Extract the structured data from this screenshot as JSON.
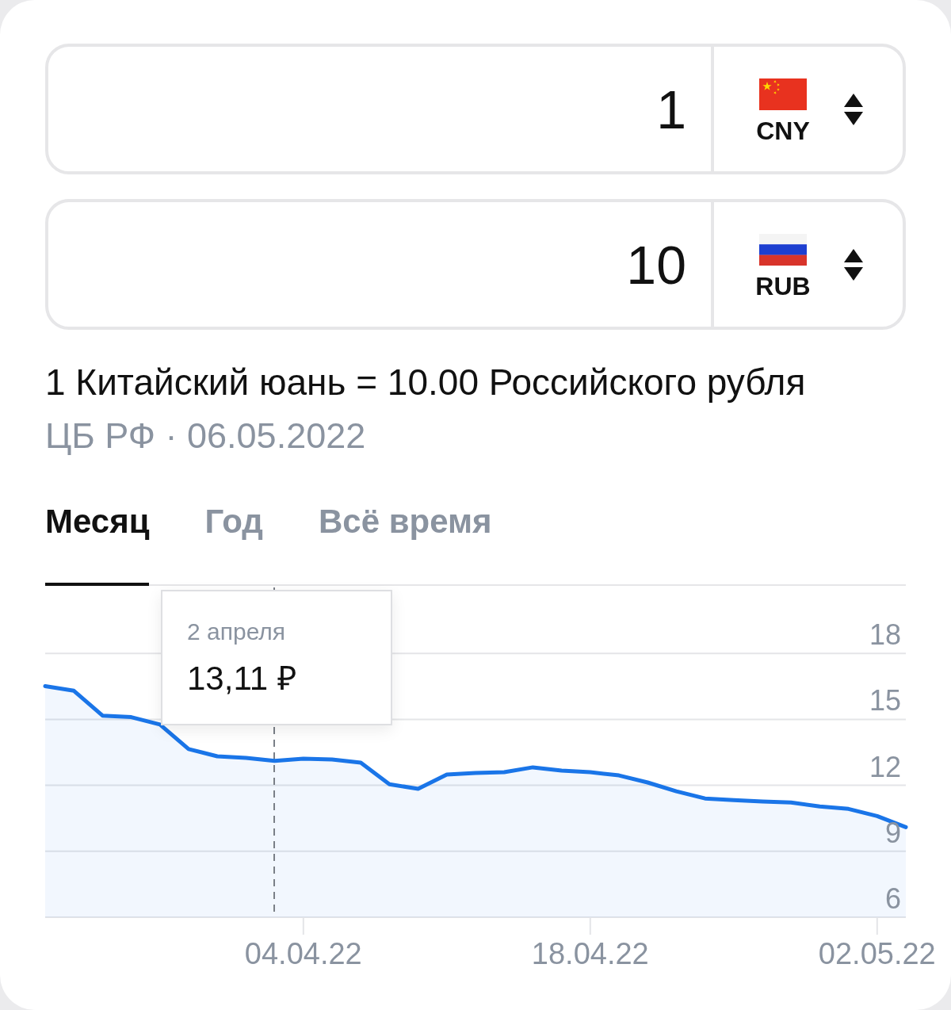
{
  "converter": [
    {
      "amount": "1",
      "code": "CNY",
      "kind": "china"
    },
    {
      "amount": "10",
      "code": "RUB",
      "kind": "russia"
    }
  ],
  "rate": {
    "text": "1 Китайский юань = 10.00 Российского рубля",
    "source": "ЦБ РФ · 06.05.2022"
  },
  "tabs": [
    {
      "label": "Месяц",
      "selected": true
    },
    {
      "label": "Год",
      "selected": false
    },
    {
      "label": "Всё время",
      "selected": false
    }
  ],
  "chart": {
    "tooltip": {
      "date": "2 апреля",
      "value": "13,11 ₽"
    },
    "chart_data": {
      "type": "area",
      "categories": [
        null,
        null,
        null,
        null,
        null,
        null,
        null,
        null,
        null,
        "04.04.22",
        null,
        null,
        null,
        null,
        null,
        null,
        null,
        null,
        null,
        "18.04.22",
        null,
        null,
        null,
        null,
        null,
        null,
        null,
        null,
        null,
        "02.05.22",
        null
      ],
      "series": [
        {
          "color": "#1a75e8",
          "values": [
            16.51,
            16.3,
            15.17,
            15.1,
            14.77,
            13.65,
            13.32,
            13.25,
            13.11,
            13.21,
            13.18,
            13.03,
            12.05,
            11.84,
            12.49,
            12.56,
            12.6,
            12.82,
            12.67,
            12.6,
            12.45,
            12.13,
            11.73,
            11.4,
            11.33,
            11.26,
            11.22,
            11.04,
            10.93,
            10.6,
            10.1
          ]
        }
      ],
      "ylim": [
        6,
        21
      ],
      "yticks": [
        6,
        9,
        12,
        15,
        18
      ],
      "grid": true
    }
  }
}
